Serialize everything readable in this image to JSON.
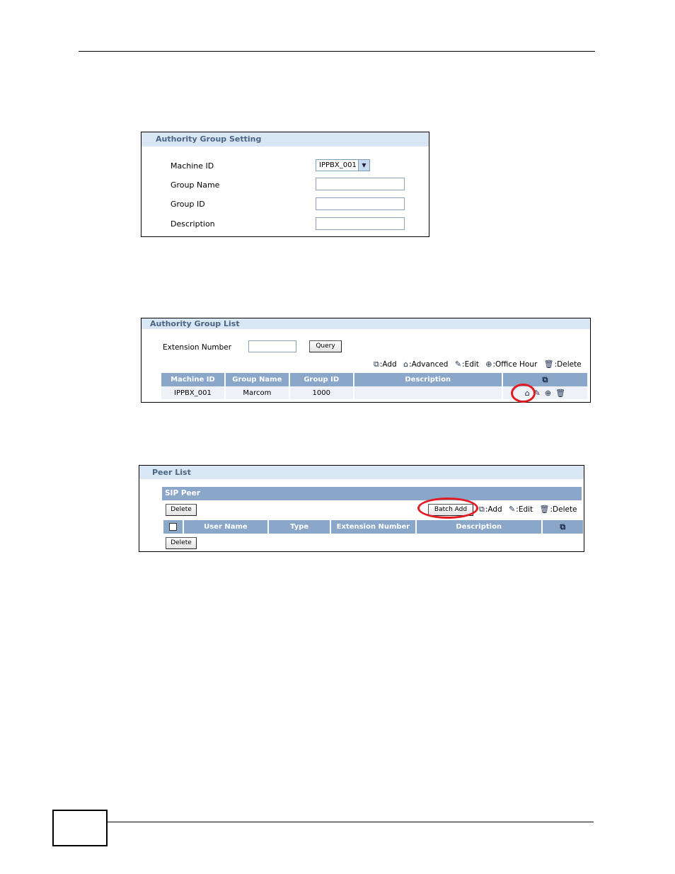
{
  "setting_panel": {
    "title": "Authority Group Setting",
    "fields": [
      {
        "label": "Machine ID",
        "value": "IPPBX_001"
      },
      {
        "label": "Group Name",
        "value": ""
      },
      {
        "label": "Group ID",
        "value": ""
      },
      {
        "label": "Description",
        "value": ""
      }
    ]
  },
  "group_list_panel": {
    "title": "Authority Group List",
    "extension_label": "Extension Number",
    "extension_value": "",
    "query_label": "Query",
    "legend": {
      "add": ":Add",
      "advanced": ":Advanced",
      "edit": ":Edit",
      "office_hour": ":Office Hour",
      "delete": ":Delete"
    },
    "columns": [
      "Machine ID",
      "Group Name",
      "Group ID",
      "Description"
    ],
    "rows": [
      {
        "machine_id": "IPPBX_001",
        "group_name": "Marcom",
        "group_id": "1000",
        "description": ""
      }
    ]
  },
  "peer_list_panel": {
    "title": "Peer List",
    "section_title": "SIP Peer",
    "delete_label": "Delete",
    "batch_add_label": "Batch Add",
    "legend": {
      "add": ":Add",
      "edit": ":Edit",
      "delete": ":Delete"
    },
    "columns": [
      "User Name",
      "Type",
      "Extension Number",
      "Description"
    ]
  },
  "colors": {
    "panel_header_bg": "#d9e6f3",
    "panel_header_text": "#4a6685",
    "table_header_bg": "#8aa6c8",
    "highlight": "#e31b23"
  },
  "icons": [
    "add-icon",
    "advanced-icon",
    "edit-icon",
    "office-hour-icon",
    "delete-icon"
  ]
}
